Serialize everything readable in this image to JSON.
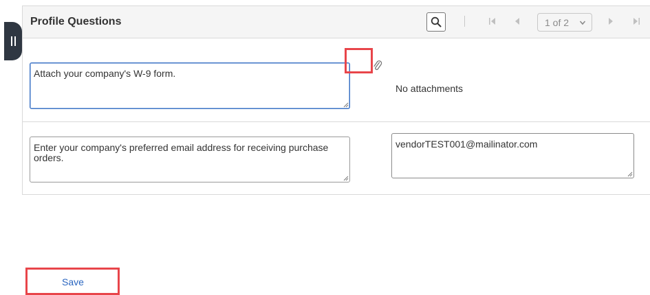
{
  "panel": {
    "title": "Profile Questions",
    "pager": "1 of 2"
  },
  "questions": [
    {
      "question": "Attach your company's W-9 form.",
      "answer": "No attachments"
    },
    {
      "question": "Enter your company's preferred email address for receiving purchase orders.",
      "answer": "vendorTEST001@mailinator.com"
    }
  ],
  "actions": {
    "save_label": "Save"
  },
  "icons": {
    "search": "search-icon",
    "first": "first-page-icon",
    "prev": "previous-page-icon",
    "next": "next-page-icon",
    "last": "last-page-icon",
    "attach": "paperclip-icon",
    "collapse": "collapse-handle-icon"
  },
  "colors": {
    "highlight": "#e8454a",
    "link": "#2a66c0",
    "focus": "#3a72c5"
  }
}
